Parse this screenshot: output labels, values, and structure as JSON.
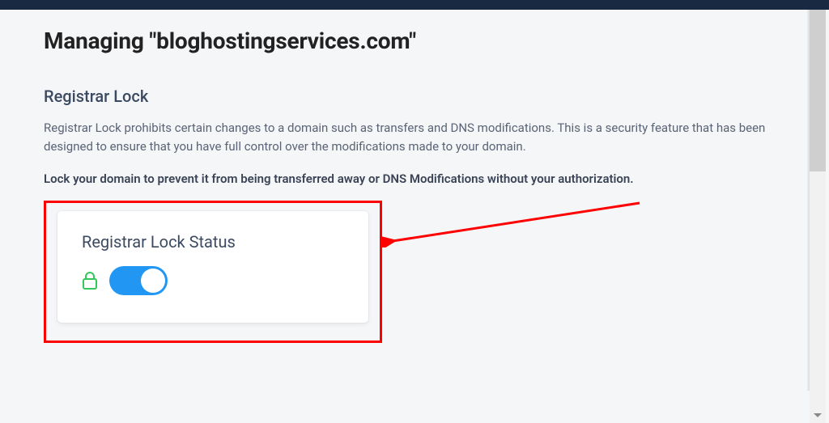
{
  "page": {
    "title": "Managing \"bloghostingservices.com\""
  },
  "section": {
    "heading": "Registrar Lock",
    "description": "Registrar Lock prohibits certain changes to a domain such as transfers and DNS modifications. This is a security feature that has been designed to ensure that you have full control over the modifications made to your domain.",
    "bold_note": "Lock your domain to prevent it from being transferred away or DNS Modifications without your authorization."
  },
  "card": {
    "title": "Registrar Lock Status",
    "locked": true
  },
  "colors": {
    "toggle_on": "#2196f3",
    "lock_green": "#34c759",
    "annotation_red": "#ff0000"
  }
}
